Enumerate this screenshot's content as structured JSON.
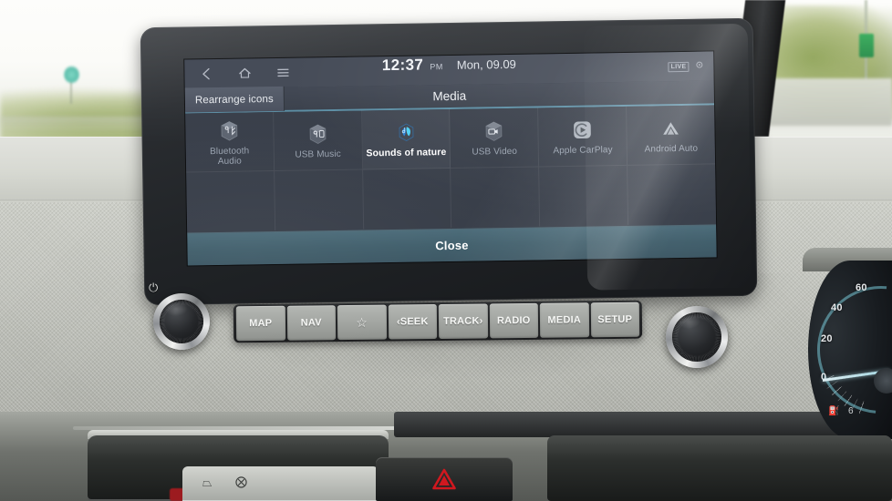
{
  "status_bar": {
    "back_icon": "back-arrow-icon",
    "home_icon": "home-icon",
    "menu_icon": "hamburger-menu-icon",
    "time": "12:37",
    "am_pm": "PM",
    "date": "Mon, 09.09",
    "badge": "LIVE",
    "settings_icon": "gear-icon"
  },
  "header": {
    "rearrange_label": "Rearrange icons",
    "title": "Media"
  },
  "grid": {
    "items": [
      {
        "label": "Bluetooth\nAudio",
        "label_line1": "Bluetooth",
        "label_line2": "Audio",
        "icon": "bluetooth-audio-cube-icon",
        "selected": false
      },
      {
        "label": "USB Music",
        "label_line1": "USB Music",
        "label_line2": "",
        "icon": "usb-music-cube-icon",
        "selected": false
      },
      {
        "label": "Sounds of nature",
        "label_line1": "Sounds of nature",
        "label_line2": "",
        "icon": "sounds-of-nature-leaf-icon",
        "selected": true
      },
      {
        "label": "USB Video",
        "label_line1": "USB Video",
        "label_line2": "",
        "icon": "usb-video-cube-icon",
        "selected": false
      },
      {
        "label": "Apple CarPlay",
        "label_line1": "Apple CarPlay",
        "label_line2": "",
        "icon": "apple-carplay-icon",
        "selected": false
      },
      {
        "label": "Android Auto",
        "label_line1": "Android Auto",
        "label_line2": "",
        "icon": "android-auto-icon",
        "selected": false
      }
    ]
  },
  "footer": {
    "close_label": "Close"
  },
  "hardware_buttons": [
    {
      "label": "MAP",
      "name": "map-button"
    },
    {
      "label": "NAV",
      "name": "nav-button"
    },
    {
      "label": "☆",
      "name": "favorite-star-button"
    },
    {
      "label": "‹SEEK",
      "name": "seek-back-button"
    },
    {
      "label": "TRACK›",
      "name": "track-forward-button"
    },
    {
      "label": "RADIO",
      "name": "radio-button"
    },
    {
      "label": "MEDIA",
      "name": "media-button"
    },
    {
      "label": "SETUP",
      "name": "setup-button"
    }
  ],
  "knobs": {
    "power_symbol": "⏻",
    "left_name": "power-volume-knob",
    "right_name": "tune-knob"
  },
  "cluster": {
    "gauge_ticks": [
      "0",
      "20",
      "40",
      "60"
    ],
    "fuel_icon": "fuel-pump-icon",
    "fuel_value": "6"
  },
  "colors": {
    "screen_bg": "#2e3440",
    "status_bg": "#464c58",
    "accent_underline": "#5d8fa5",
    "close_bar": "#3f5d6a",
    "selected_icon": "#3ea8e0",
    "dim_label": "#9aa3b0",
    "active_label": "#ffffff",
    "hazard_red": "#d0181f"
  }
}
